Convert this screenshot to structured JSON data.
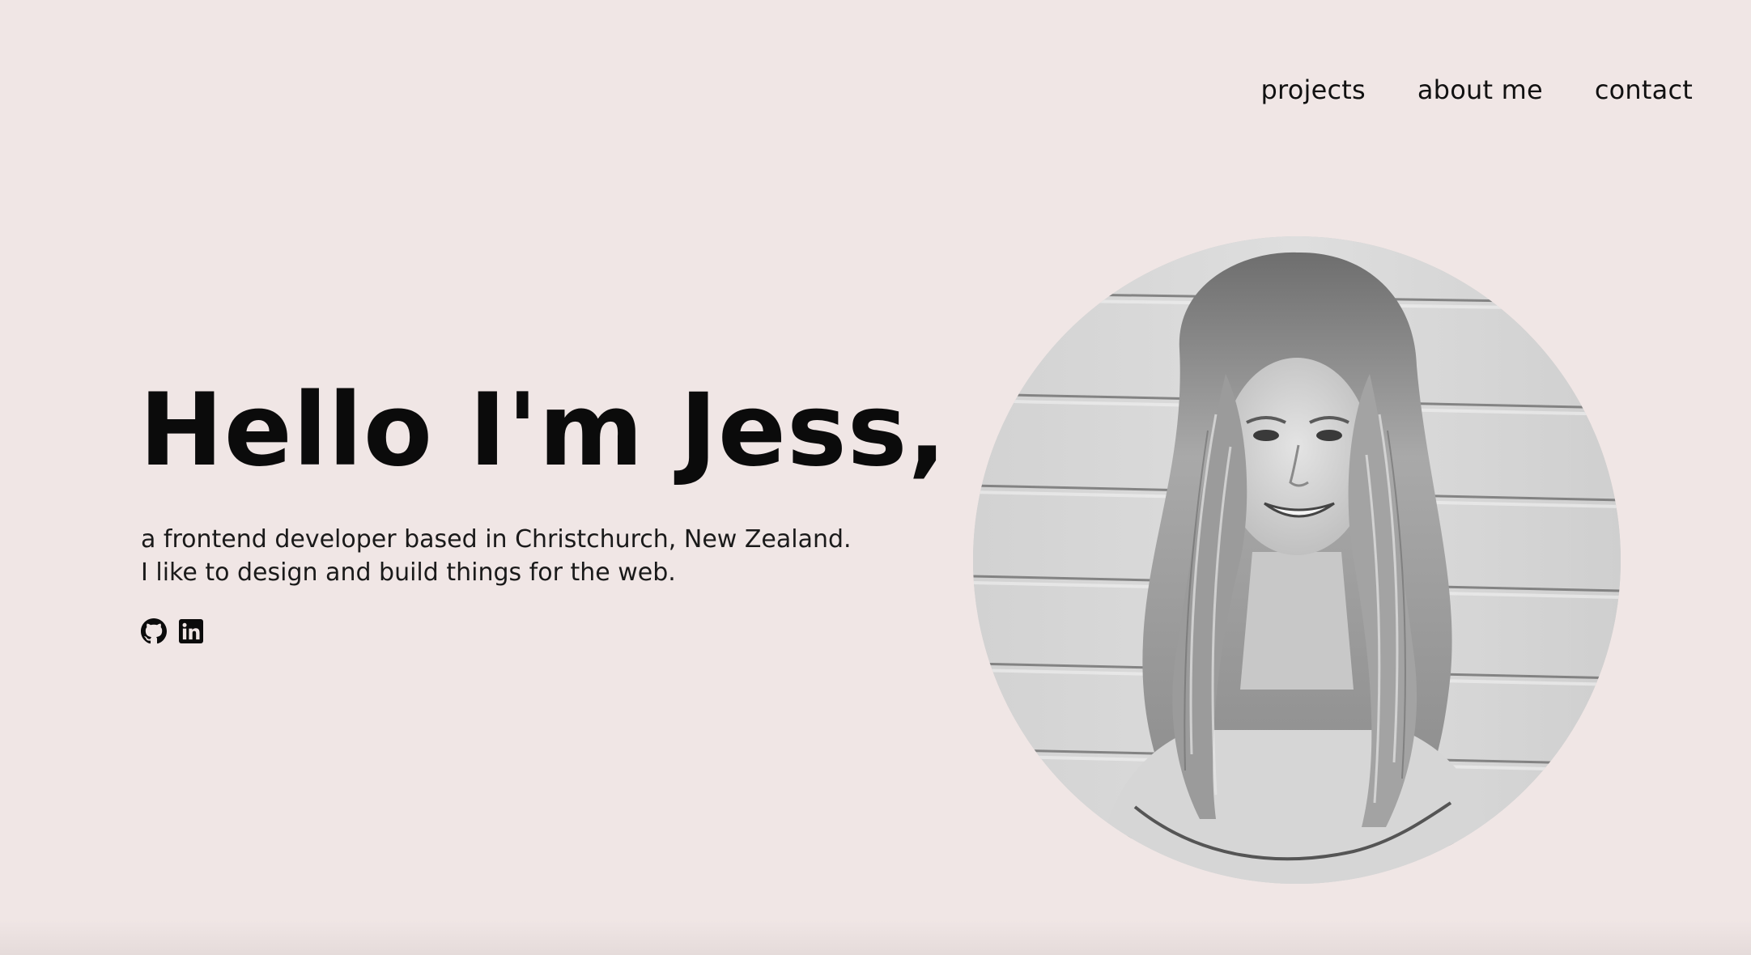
{
  "nav": {
    "items": [
      {
        "label": "projects"
      },
      {
        "label": "about me"
      },
      {
        "label": "contact"
      }
    ]
  },
  "hero": {
    "title": "Hello I'm Jess,",
    "subtitle_line1": "a frontend developer based in Christchurch, New Zealand.",
    "subtitle_line2": "I like to design and build things for the web.",
    "socials": [
      {
        "icon": "github-icon"
      },
      {
        "icon": "linkedin-icon"
      }
    ]
  },
  "portrait": {
    "icon": "portrait-photo",
    "style": "grayscale"
  },
  "colors": {
    "background": "#f0e6e5",
    "text": "#111111"
  }
}
